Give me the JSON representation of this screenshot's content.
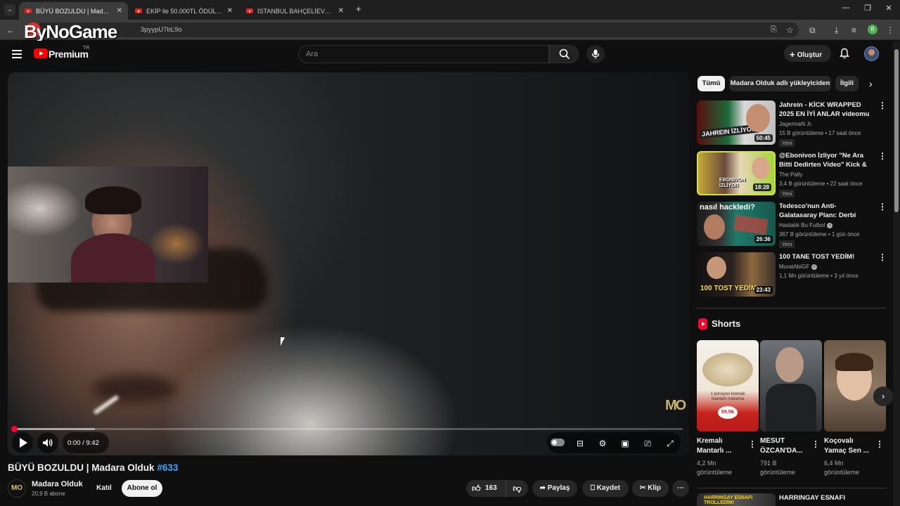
{
  "browser": {
    "tabs": [
      {
        "title": "BÜYÜ BOZULDU | Madara Olduk",
        "active": true
      },
      {
        "title": "EKİP ile 50.000TL ÖDÜLLÜ MMA",
        "active": false
      },
      {
        "title": "İSTANBUL BAHÇELİEVLER'DE BİR",
        "active": false
      }
    ],
    "url": "3pyypU7bL9o",
    "profile_initial": "B",
    "watermark": "ByNoGame"
  },
  "header": {
    "brand": "Premium",
    "region": "TR",
    "search_placeholder": "Ara",
    "create_label": "Oluştur"
  },
  "player": {
    "time": "0:00 / 9:42",
    "progress_fraction": 0,
    "channel_watermark": "MO"
  },
  "video": {
    "title": "BÜYÜ BOZULDU | Madara Olduk",
    "hashtag": "#633",
    "channel": "Madara Olduk",
    "channel_initials": "MO",
    "subscribers": "20,9 B abone",
    "join_label": "Katıl",
    "subscribe_label": "Abone ol",
    "likes": "163",
    "share_label": "Paylaş",
    "save_label": "Kaydet",
    "clip_label": "Klip"
  },
  "filters": [
    "Tümü",
    "Madara Olduk adlı yükleyiciden",
    "İlgili"
  ],
  "recommendations": [
    {
      "title": "Jahrein - KİCK WRAPPED 2025 EN İYİ ANLAR videomu izliyor",
      "channel": "JagermaN Jr.",
      "meta": "15 B görüntüleme • 17 saat önce",
      "badge": "Yeni",
      "duration": "50:45",
      "thumb_text": "JAHREIN İZLİYOR",
      "verified": false
    },
    {
      "title": "@Ebonivon İzliyor \"Ne Ara Bitti Dedirten Video\" Kick & Twitch ...",
      "channel": "The Pally",
      "meta": "3,4 B görüntüleme • 22 saat önce",
      "badge": "Yeni",
      "duration": "18:28",
      "thumb_text": "EBONIVON İZLİYOR",
      "verified": false
    },
    {
      "title": "Tedesco'nun Anti-Galatasaray Planı: Derbi Nasıl Hacklendi?",
      "channel": "Hastalık Bu Futbol",
      "meta": "367 B görüntüleme • 1 gün önce",
      "badge": "Yeni",
      "duration": "26:36",
      "thumb_text": "nasıl hackledi?",
      "verified": true
    },
    {
      "title": "100 TANE TOST YEDİM!",
      "channel": "MuratAbiGF",
      "meta": "1,1 Mn görüntüleme • 3 yıl önce",
      "badge": "",
      "duration": "23:43",
      "thumb_text": "100 TOST YEDİM",
      "verified": true
    }
  ],
  "shorts": {
    "heading": "Shorts",
    "items": [
      {
        "title": "Kremalı Mantarlı ...",
        "views": "4,2 Mn görüntüleme",
        "thumb_text": "1 porsiyon kremalı mantarlı makarna",
        "price": "69,5₺"
      },
      {
        "title": "MESUT ÖZCAN'DA...",
        "views": "791 B görüntüleme"
      },
      {
        "title": "Koçovalı Yamaç Sen ...",
        "views": "6,4 Mn görüntüleme"
      }
    ]
  },
  "next_rec": {
    "title": "HARRINGAY ESNAFI",
    "thumb_text": "HARRINGAY ESNAFI TROLLEDİM!"
  }
}
